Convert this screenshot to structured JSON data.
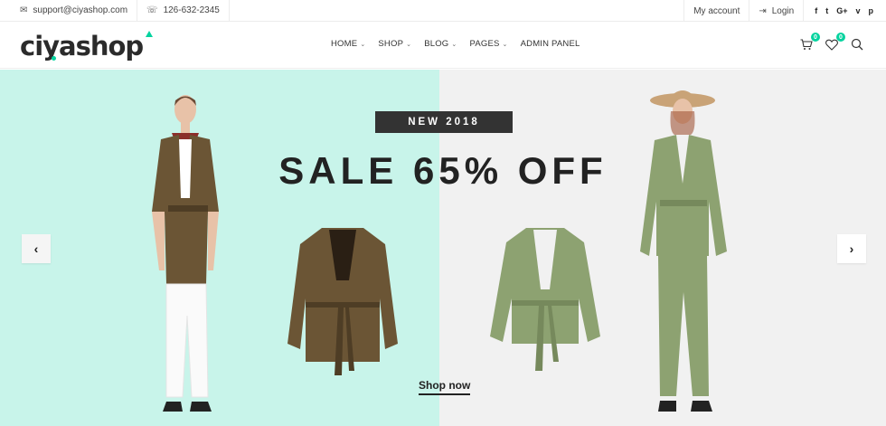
{
  "topbar": {
    "email": "support@ciyashop.com",
    "phone": "126-632-2345",
    "my_account": "My account",
    "login": "Login",
    "social": [
      "f",
      "t",
      "G+",
      "v",
      "p"
    ]
  },
  "header": {
    "logo_text": "ciyashop",
    "nav": [
      {
        "label": "HOME",
        "has_dropdown": true
      },
      {
        "label": "SHOP",
        "has_dropdown": true
      },
      {
        "label": "BLOG",
        "has_dropdown": true
      },
      {
        "label": "PAGES",
        "has_dropdown": true
      },
      {
        "label": "ADMIN PANEL",
        "has_dropdown": false
      }
    ],
    "cart_count": "0",
    "wishlist_count": "0",
    "icons": [
      "cart-icon",
      "heart-icon",
      "search-icon"
    ]
  },
  "hero": {
    "tag": "NEW 2018",
    "headline": "SALE 65% OFF",
    "cta": "Shop now",
    "prev_arrow": "‹",
    "next_arrow": "›"
  },
  "colors": {
    "accent": "#04d39f",
    "hero_left_bg": "#c8f4ea",
    "hero_right_bg": "#f1f1f1",
    "tag_bg": "#333333",
    "jacket_brown": "#6b5535",
    "jacket_green": "#8da271"
  }
}
